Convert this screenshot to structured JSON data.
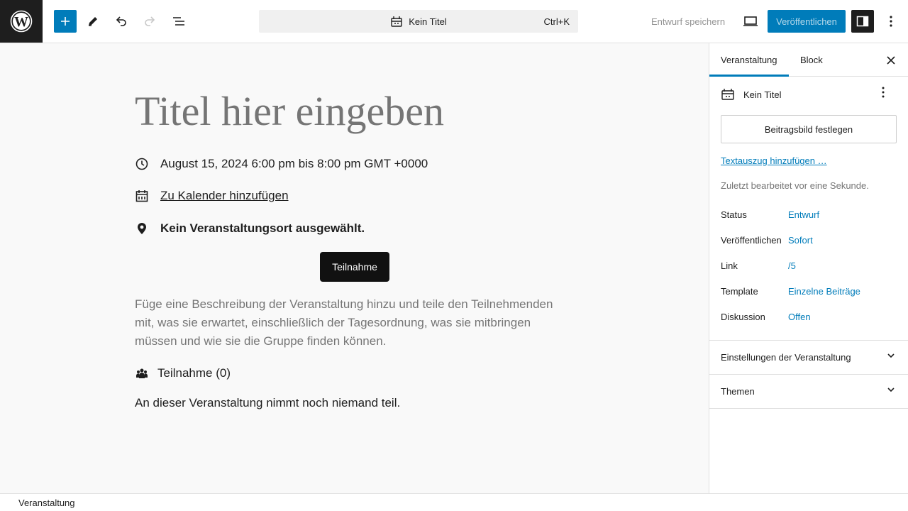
{
  "topbar": {
    "command_bar": {
      "title": "Kein Titel",
      "shortcut": "Ctrl+K"
    },
    "save_draft_label": "Entwurf speichern",
    "publish_label": "Veröffentlichen",
    "accent_color": "#007cba"
  },
  "canvas": {
    "title_placeholder": "Titel hier eingeben",
    "datetime": "August 15, 2024 6:00 pm bis 8:00 pm GMT +0000",
    "calendar_link": "Zu Kalender hinzufügen",
    "venue": "Kein Veranstaltungsort ausgewählt.",
    "attend_button": "Teilnahme",
    "description_placeholder": "Füge eine Beschreibung der Veranstaltung hinzu und teile den Teilnehmenden mit, was sie erwartet, einschließlich der Tagesordnung, was sie mitbringen müssen und wie sie die Gruppe finden können.",
    "attendees_heading": "Teilnahme (0)",
    "no_attendees": "An dieser Veranstaltung nimmt noch niemand teil."
  },
  "sidebar": {
    "tabs": [
      {
        "label": "Veranstaltung",
        "active": true
      },
      {
        "label": "Block",
        "active": false
      }
    ],
    "post_title": "Kein Titel",
    "featured_image_button": "Beitragsbild festlegen",
    "excerpt_link": "Textauszug hinzufügen …",
    "last_edited": "Zuletzt bearbeitet vor eine Sekunde.",
    "info": [
      {
        "key": "Status",
        "value": "Entwurf"
      },
      {
        "key": "Veröffentlichen",
        "value": "Sofort"
      },
      {
        "key": "Link",
        "value": "/5"
      },
      {
        "key": "Template",
        "value": "Einzelne Beiträge"
      },
      {
        "key": "Diskussion",
        "value": "Offen"
      }
    ],
    "panels": [
      {
        "label": "Einstellungen der Veranstaltung"
      },
      {
        "label": "Themen"
      }
    ]
  },
  "footer": {
    "breadcrumb": "Veranstaltung"
  }
}
